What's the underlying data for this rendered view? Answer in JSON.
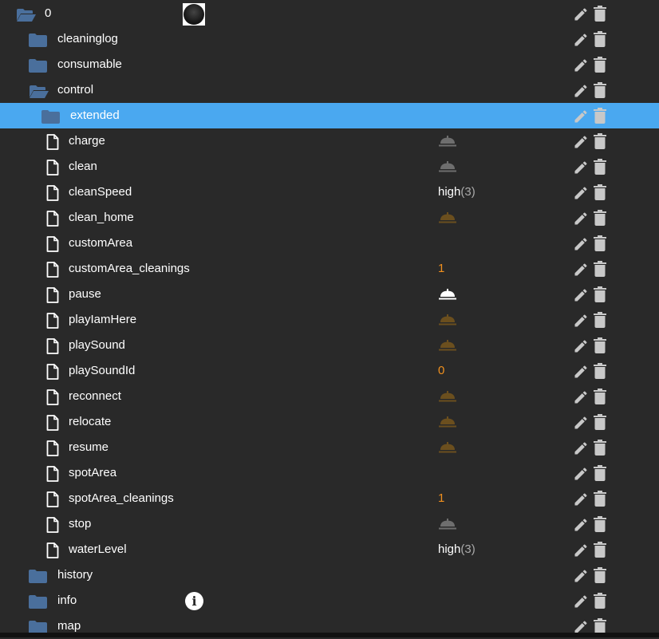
{
  "colors": {
    "folder": "#4a6f9c",
    "selected": "#4aa8f0",
    "bell_off": "#6e6e6e",
    "bell_true": "#6b4f1e",
    "bell_white": "#ffffff",
    "number": "#f0901e",
    "action": "#c8c8c8"
  },
  "rows": [
    {
      "name": "0",
      "level": 0,
      "icon": "folder-open-icon",
      "extra": "device-image"
    },
    {
      "name": "cleaninglog",
      "level": 1,
      "icon": "folder-icon"
    },
    {
      "name": "consumable",
      "level": 1,
      "icon": "folder-icon"
    },
    {
      "name": "control",
      "level": 1,
      "icon": "folder-open-icon"
    },
    {
      "name": "extended",
      "level": 2,
      "icon": "folder-icon",
      "selected": true
    },
    {
      "name": "charge",
      "level": 2,
      "icon": "file-icon",
      "bell": "off"
    },
    {
      "name": "clean",
      "level": 2,
      "icon": "file-icon",
      "bell": "off"
    },
    {
      "name": "cleanSpeed",
      "level": 2,
      "icon": "file-icon",
      "value": "high",
      "value_suffix": "(3)"
    },
    {
      "name": "clean_home",
      "level": 2,
      "icon": "file-icon",
      "bell": "true"
    },
    {
      "name": "customArea",
      "level": 2,
      "icon": "file-icon"
    },
    {
      "name": "customArea_cleanings",
      "level": 2,
      "icon": "file-icon",
      "number": "1"
    },
    {
      "name": "pause",
      "level": 2,
      "icon": "file-icon",
      "bell": "white"
    },
    {
      "name": "playIamHere",
      "level": 2,
      "icon": "file-icon",
      "bell": "true"
    },
    {
      "name": "playSound",
      "level": 2,
      "icon": "file-icon",
      "bell": "true"
    },
    {
      "name": "playSoundId",
      "level": 2,
      "icon": "file-icon",
      "number": "0"
    },
    {
      "name": "reconnect",
      "level": 2,
      "icon": "file-icon",
      "bell": "true"
    },
    {
      "name": "relocate",
      "level": 2,
      "icon": "file-icon",
      "bell": "true"
    },
    {
      "name": "resume",
      "level": 2,
      "icon": "file-icon",
      "bell": "true"
    },
    {
      "name": "spotArea",
      "level": 2,
      "icon": "file-icon"
    },
    {
      "name": "spotArea_cleanings",
      "level": 2,
      "icon": "file-icon",
      "number": "1"
    },
    {
      "name": "stop",
      "level": 2,
      "icon": "file-icon",
      "bell": "off"
    },
    {
      "name": "waterLevel",
      "level": 2,
      "icon": "file-icon",
      "value": "high",
      "value_suffix": "(3)"
    },
    {
      "name": "history",
      "level": 1,
      "icon": "folder-icon"
    },
    {
      "name": "info",
      "level": 1,
      "icon": "folder-icon",
      "extra": "info-icon",
      "info_glyph": "i"
    },
    {
      "name": "map",
      "level": 1,
      "icon": "folder-icon"
    }
  ]
}
